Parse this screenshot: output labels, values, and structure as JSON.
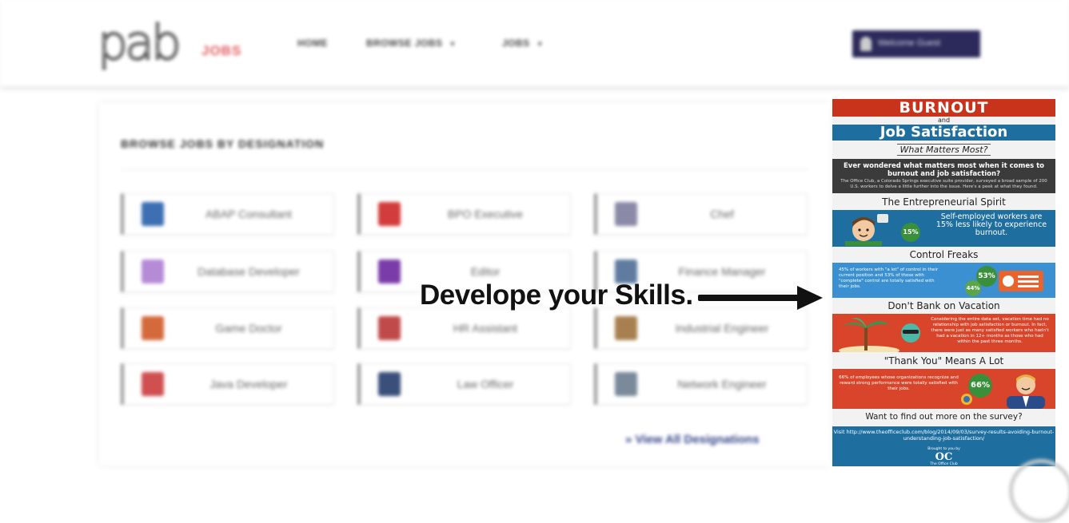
{
  "site": {
    "logo_mark": "pab",
    "logo_sub": "JOBS",
    "nav": {
      "home": "HOME",
      "browse": "BROWSE JOBS",
      "jobs": "JOBS"
    },
    "user_button": "Welcome Guest",
    "section_title": "BROWSE JOBS BY DESIGNATION",
    "designations": [
      {
        "label": "ABAP Consultant",
        "icon": "code-doc-icon",
        "color": "#3d6fb3"
      },
      {
        "label": "BPO Executive",
        "icon": "headset-person-icon",
        "color": "#d23c3c"
      },
      {
        "label": "Chef",
        "icon": "chef-icon",
        "color": "#8a8aa8"
      },
      {
        "label": "Database Developer",
        "icon": "database-icon",
        "color": "#b58ad6"
      },
      {
        "label": "Editor",
        "icon": "editor-pen-icon",
        "color": "#7a3ca8"
      },
      {
        "label": "Finance Manager",
        "icon": "finance-icon",
        "color": "#5f7ca0"
      },
      {
        "label": "Game Doctor",
        "icon": "doctor-icon",
        "color": "#d46a3c"
      },
      {
        "label": "HR Assistant",
        "icon": "hr-group-icon",
        "color": "#c04a4a"
      },
      {
        "label": "Industrial Engineer",
        "icon": "engineer-icon",
        "color": "#a88050"
      },
      {
        "label": "Java Developer",
        "icon": "java-dev-icon",
        "color": "#d05050"
      },
      {
        "label": "Law Officer",
        "icon": "law-officer-icon",
        "color": "#3a4f7a"
      },
      {
        "label": "Network Engineer",
        "icon": "network-icon",
        "color": "#7a8a9a"
      }
    ],
    "view_all": "View All Designations"
  },
  "caption": "Develope your Skills.",
  "infographic": {
    "title_top": "BURNOUT",
    "title_and": "and",
    "title_bottom": "Job Satisfaction",
    "subtitle": "What Matters Most?",
    "intro_question": "Ever wondered what matters most when it comes to burnout and job satisfaction?",
    "intro_body": "The Office Club, a Colorado Springs executive suite provider, surveyed a broad sample of 200 U.S. workers to delve a little further into the issue. Here's a peek at what they found.",
    "sections": [
      {
        "heading": "The Entrepreneurial Spirit",
        "text": "Self-employed workers are 15% less likely to experience burnout.",
        "percent": "15%"
      },
      {
        "heading": "Control Freaks",
        "text": "45% of workers with \"a lot\" of control in their current position and 53% of those with \"complete\" control are totally satisfied with their jobs.",
        "percent_a": "53%",
        "percent_b": "44%"
      },
      {
        "heading": "Don't Bank on Vacation",
        "text": "Considering the entire data set, vacation time had no relationship with job satisfaction or burnout. In fact, there were just as many satisfied workers who hadn't had a vacation in 12+ months as those who had within the past three months."
      },
      {
        "heading": "\"Thank You\" Means A Lot",
        "text": "66% of employees whose organizations recognize and reward strong performance were totally satisfied with their jobs.",
        "percent": "66%"
      }
    ],
    "cta": "Want to find out more on the survey?",
    "link": "Visit http://www.theofficeclub.com/blog/2014/09/03/survey-results-avoiding-burnout-understanding-job-satisfaction/",
    "brought_by": "Brought to you by",
    "brand_mark": "OC",
    "brand_name": "The Office Club"
  },
  "colors": {
    "infographic_red": "#c8331c",
    "infographic_blue": "#1e6fa0",
    "infographic_green": "#3a8f3a",
    "nav_user_bg": "#2c2a5a"
  }
}
